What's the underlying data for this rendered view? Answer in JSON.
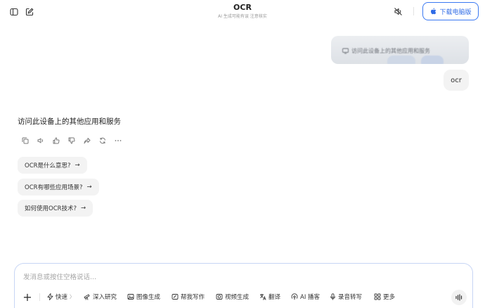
{
  "header": {
    "title": "OCR",
    "subtitle": "AI 生成可能有误 注意核实",
    "download_label": "下载电脑版",
    "colors": {
      "accent": "#2f6be6"
    }
  },
  "conversation": {
    "image_caption": "访问此设备上的其他应用和服务",
    "user_message": "ocr",
    "ai_message": "访问此设备上的其他应用和服务",
    "actions": [
      "copy-icon",
      "speaker-icon",
      "thumbs-up-icon",
      "thumbs-down-icon",
      "share-icon",
      "regenerate-icon",
      "more-icon"
    ],
    "suggestions": [
      {
        "label": "OCR是什么意思?",
        "arrow": "→"
      },
      {
        "label": "OCR有哪些应用场景?",
        "arrow": "→"
      },
      {
        "label": "如何使用OCR技术?",
        "arrow": "→"
      }
    ]
  },
  "composer": {
    "placeholder": "发消息或按住空格说话...",
    "plus": "+",
    "tools": [
      {
        "label": "快速",
        "suffix": "〉",
        "icon": "lightning-icon"
      },
      {
        "label": "深入研究",
        "icon": "telescope-icon"
      },
      {
        "label": "图像生成",
        "icon": "image-icon"
      },
      {
        "label": "帮我写作",
        "icon": "pen-icon"
      },
      {
        "label": "视频生成",
        "icon": "video-icon"
      },
      {
        "label": "翻译",
        "icon": "translate-icon"
      },
      {
        "label": "AI 播客",
        "icon": "podcast-icon"
      },
      {
        "label": "录音转写",
        "icon": "microphone-icon"
      },
      {
        "label": "更多",
        "icon": "grid-icon"
      }
    ]
  }
}
